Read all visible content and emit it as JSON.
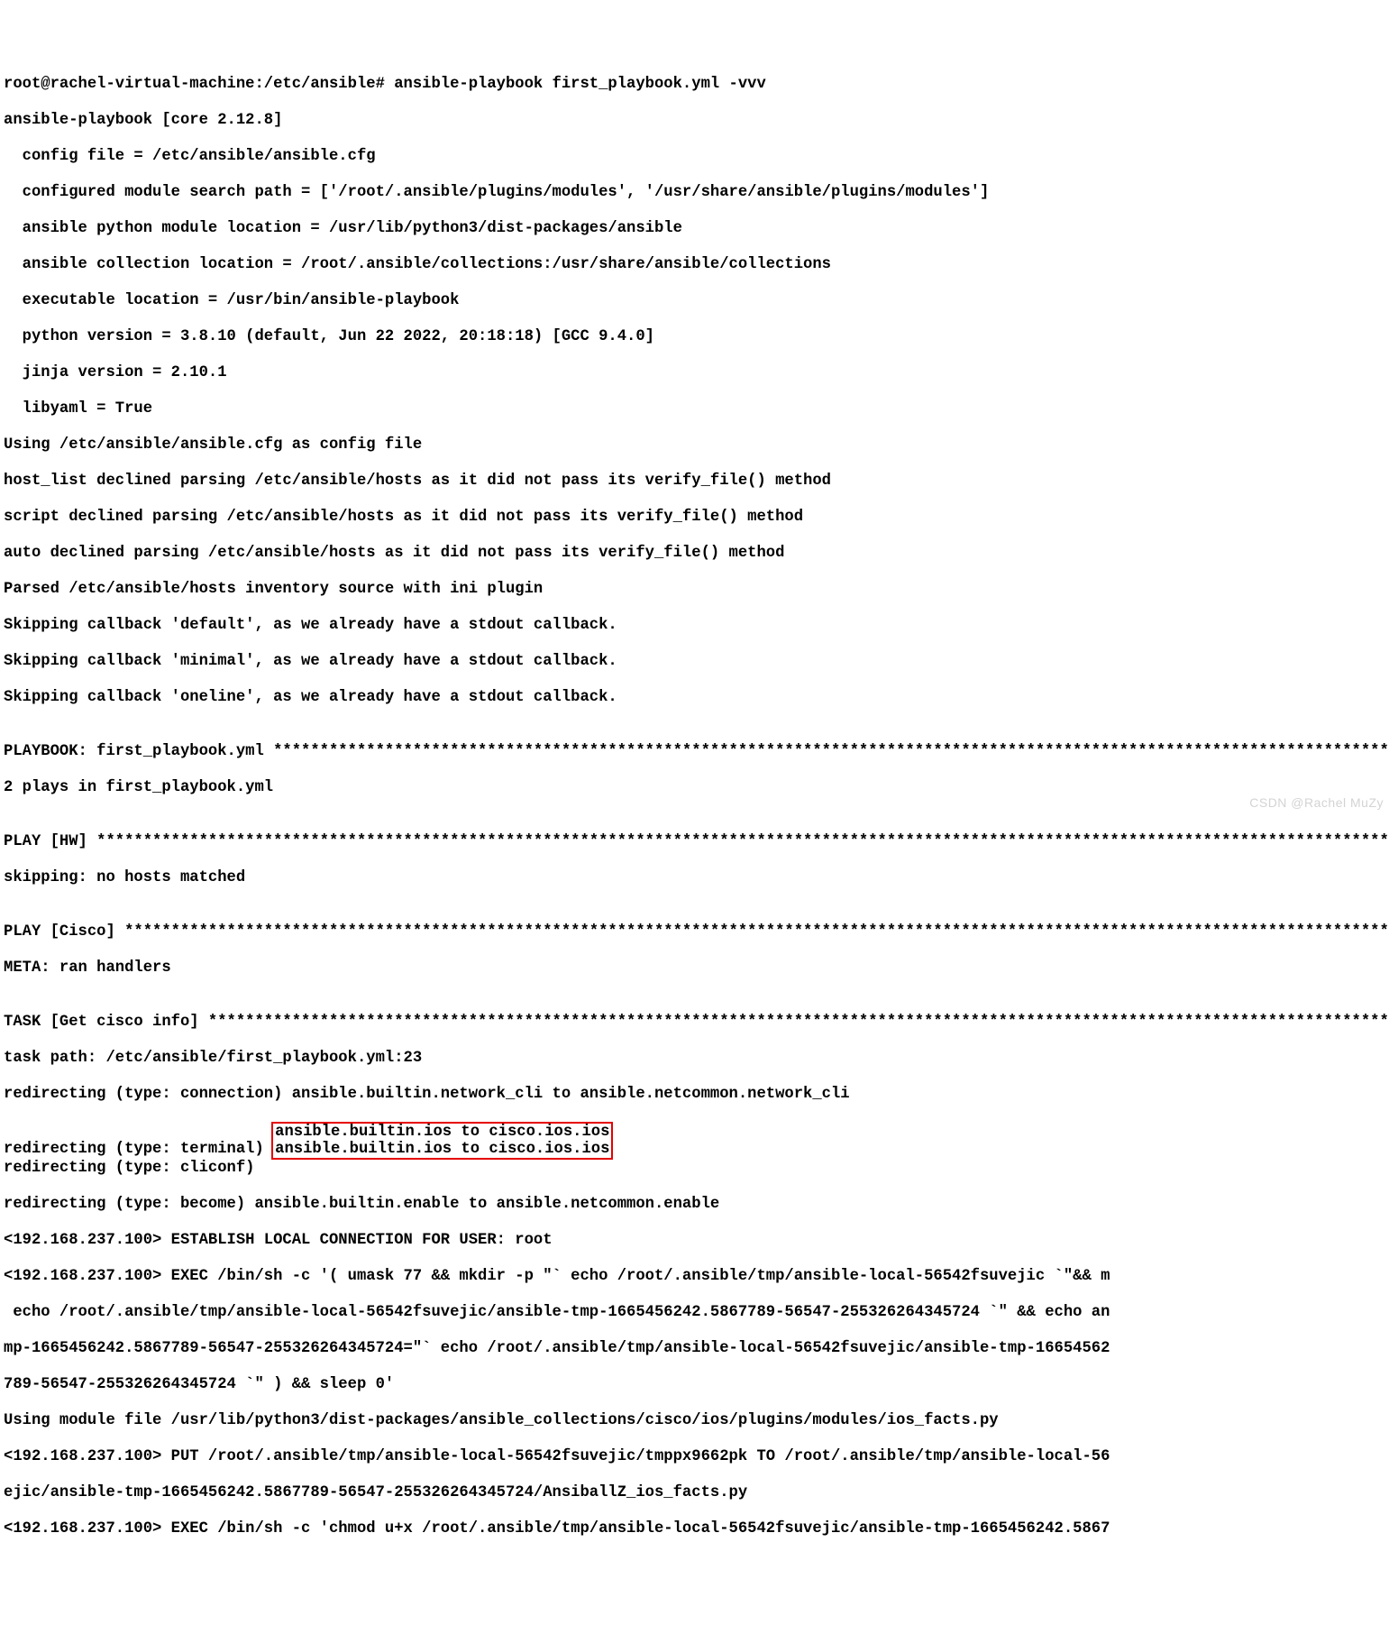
{
  "lines": {
    "l00": "root@rachel-virtual-machine:/etc/ansible# ansible-playbook first_playbook.yml -vvv",
    "l01": "ansible-playbook [core 2.12.8]",
    "l02": "  config file = /etc/ansible/ansible.cfg",
    "l03": "  configured module search path = ['/root/.ansible/plugins/modules', '/usr/share/ansible/plugins/modules']",
    "l04": "  ansible python module location = /usr/lib/python3/dist-packages/ansible",
    "l05": "  ansible collection location = /root/.ansible/collections:/usr/share/ansible/collections",
    "l06": "  executable location = /usr/bin/ansible-playbook",
    "l07": "  python version = 3.8.10 (default, Jun 22 2022, 20:18:18) [GCC 9.4.0]",
    "l08": "  jinja version = 2.10.1",
    "l09": "  libyaml = True",
    "l10": "Using /etc/ansible/ansible.cfg as config file",
    "l11": "host_list declined parsing /etc/ansible/hosts as it did not pass its verify_file() method",
    "l12": "script declined parsing /etc/ansible/hosts as it did not pass its verify_file() method",
    "l13": "auto declined parsing /etc/ansible/hosts as it did not pass its verify_file() method",
    "l14": "Parsed /etc/ansible/hosts inventory source with ini plugin",
    "l15": "Skipping callback 'default', as we already have a stdout callback.",
    "l16": "Skipping callback 'minimal', as we already have a stdout callback.",
    "l17": "Skipping callback 'oneline', as we already have a stdout callback.",
    "l18": "",
    "l19": "PLAYBOOK: first_playbook.yml ************************************************************************************************************************",
    "l20": "2 plays in first_playbook.yml",
    "l21": "",
    "l22": "PLAY [HW] ***************************************************************************************************************************************************",
    "l23": "skipping: no hosts matched",
    "l24": "",
    "l25": "PLAY [Cisco] *************************************************************************************************************************************************",
    "l26": "META: ran handlers",
    "l27": "",
    "l28": "TASK [Get cisco info] ***************************************************************************************************************************************",
    "l29": "task path: /etc/ansible/first_playbook.yml:23",
    "l30": "redirecting (type: connection) ansible.builtin.network_cli to ansible.netcommon.network_cli",
    "l31a": "redirecting (type: terminal) ",
    "l31b": "ansible.builtin.ios to cisco.ios.ios",
    "l32a": "redirecting (type: cliconf) ",
    "l32b": "ansible.builtin.ios to cisco.ios.ios",
    "l33": "redirecting (type: become) ansible.builtin.enable to ansible.netcommon.enable",
    "l34": "<192.168.237.100> ESTABLISH LOCAL CONNECTION FOR USER: root",
    "l35": "<192.168.237.100> EXEC /bin/sh -c '( umask 77 && mkdir -p \"` echo /root/.ansible/tmp/ansible-local-56542fsuvejic `\"&& m",
    "l36": " echo /root/.ansible/tmp/ansible-local-56542fsuvejic/ansible-tmp-1665456242.5867789-56547-255326264345724 `\" && echo an",
    "l37": "mp-1665456242.5867789-56547-255326264345724=\"` echo /root/.ansible/tmp/ansible-local-56542fsuvejic/ansible-tmp-16654562",
    "l38": "789-56547-255326264345724 `\" ) && sleep 0'",
    "l39": "Using module file /usr/lib/python3/dist-packages/ansible_collections/cisco/ios/plugins/modules/ios_facts.py",
    "l40": "<192.168.237.100> PUT /root/.ansible/tmp/ansible-local-56542fsuvejic/tmppx9662pk TO /root/.ansible/tmp/ansible-local-56",
    "l41": "ejic/ansible-tmp-1665456242.5867789-56547-255326264345724/AnsiballZ_ios_facts.py",
    "l42": "<192.168.237.100> EXEC /bin/sh -c 'chmod u+x /root/.ansible/tmp/ansible-local-56542fsuvejic/ansible-tmp-1665456242.5867"
  },
  "watermark": "CSDN @Rachel MuZy"
}
